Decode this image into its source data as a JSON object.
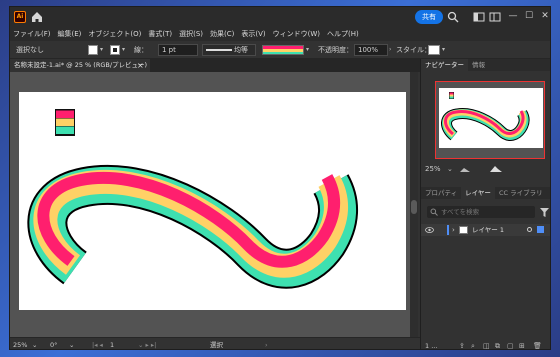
{
  "app": {
    "logo": "Ai",
    "share_label": "共有",
    "title_icons": [
      "home-icon",
      "search-icon",
      "arrange-icon",
      "panel-icon"
    ],
    "window_controls": [
      "—",
      "☐",
      "✕"
    ]
  },
  "menu": {
    "items": [
      "ファイル(F)",
      "編集(E)",
      "オブジェクト(O)",
      "書式(T)",
      "選択(S)",
      "効果(C)",
      "表示(V)",
      "ウィンドウ(W)",
      "ヘルプ(H)"
    ]
  },
  "controlbar": {
    "selection": "選択なし",
    "stroke_label": "線：",
    "stroke_value": "1 pt",
    "profile_label": "均等",
    "opacity_label": "不透明度：",
    "opacity_value": "100%",
    "style_label": "スタイル："
  },
  "document": {
    "tab_title": "名称未設定-1.ai* @ 25 % (RGB/プレビュー)",
    "tab_close": "×"
  },
  "statusbar": {
    "zoom": "25%",
    "rotation": "0°",
    "artboard": "1",
    "tool": "選択"
  },
  "navigator": {
    "tabs": [
      "ナビゲーター",
      "情報"
    ],
    "zoom": "25%"
  },
  "layers": {
    "tabs": [
      "プロパティ",
      "レイヤー",
      "CC ライブラリ"
    ],
    "search_placeholder": "すべてを検索",
    "layer_name": "レイヤー 1",
    "footer_count": "1 ..."
  },
  "colors": {
    "stripe_pink": "#ff1f6e",
    "stripe_yellow": "#ffd166",
    "stripe_teal": "#3ee0b0",
    "accent": "#1473e6"
  }
}
